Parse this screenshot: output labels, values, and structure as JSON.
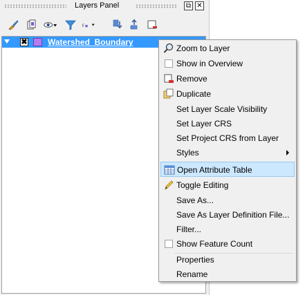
{
  "panel": {
    "title": "Layers Panel",
    "float_button": "⧉",
    "close_button": "✕"
  },
  "toolbar": {
    "tools": [
      {
        "name": "style-brush-icon"
      },
      {
        "name": "add-group-icon"
      },
      {
        "name": "visibility-eye-icon"
      },
      {
        "name": "filter-icon"
      },
      {
        "name": "filter-expression-icon"
      },
      {
        "name": "expand-all-icon"
      },
      {
        "name": "collapse-all-icon"
      },
      {
        "name": "remove-layer-icon"
      }
    ]
  },
  "layer": {
    "name": "Watershed_Boundary",
    "checked": "✖",
    "swatch_color": "#b57df2"
  },
  "context_menu": {
    "items": [
      {
        "label": "Zoom to Layer",
        "icon": "zoom-icon"
      },
      {
        "label": "Show in Overview",
        "icon": "checkbox"
      },
      {
        "label": "Remove",
        "icon": "remove-icon"
      },
      {
        "label": "Duplicate",
        "icon": "duplicate-icon"
      },
      {
        "label": "Set Layer Scale Visibility"
      },
      {
        "label": "Set Layer CRS"
      },
      {
        "label": "Set Project CRS from Layer"
      },
      {
        "label": "Styles",
        "submenu": true
      },
      {
        "label": "Open Attribute Table",
        "icon": "table-icon",
        "highlighted": true
      },
      {
        "label": "Toggle Editing",
        "icon": "pencil-icon"
      },
      {
        "label": "Save As..."
      },
      {
        "label": "Save As Layer Definition File..."
      },
      {
        "label": "Filter..."
      },
      {
        "label": "Show Feature Count",
        "icon": "checkbox"
      },
      {
        "label": "Properties"
      },
      {
        "label": "Rename"
      }
    ]
  },
  "colors": {
    "selection": "#3399ff",
    "menu_highlight": "#cce8ff",
    "menu_background": "#f0f0f0"
  }
}
